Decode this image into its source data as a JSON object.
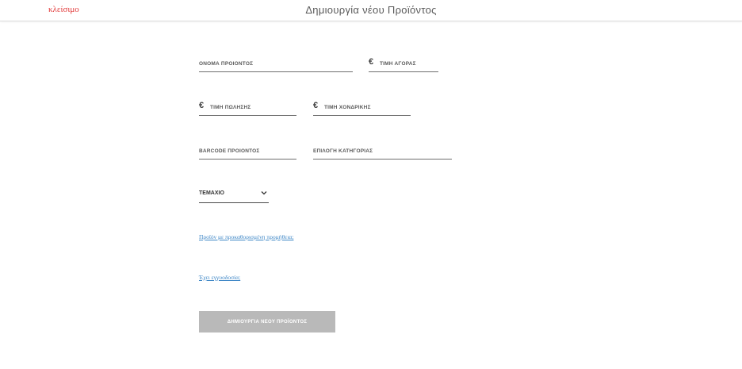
{
  "header": {
    "close_label": "κλείσιμο",
    "title": "Δημιουργία νέου Προϊόντος"
  },
  "form": {
    "currency_symbol": "€",
    "product_name_label": "ΟΝΟΜΑ ΠΡΟΙΟΝΤΟΣ",
    "purchase_price_label": "ΤΙΜΗ ΑΓΟΡΑΣ",
    "sale_price_label": "ΤΙΜΗ ΠΩΛΗΣΗΣ",
    "wholesale_price_label": "ΤΙΜΗ ΧΟΝΔΡΙΚΗΣ",
    "barcode_label": "BARCODE ΠΡΟΙΟΝΤΟΣ",
    "category_label": "ΕΠΙΛΟΓΗ ΚΑΤΗΓΟΡΙΑΣ",
    "unit_select_value": "ΤΕΜΑΧΙΟ",
    "predefined_supply_link": "Προϊόν με προκαθορισμένη προμήθεια;",
    "warranty_link": "Έχει εγγυοδοσία;",
    "submit_label": "ΔΗΜΙΟΥΡΓΙΑ ΝΕΟΥ ΠΡΟΪΟΝΤΟΣ"
  },
  "colors": {
    "close_link": "#e23b3b",
    "link": "#3d86c6",
    "submit_bg": "#b9b9b9"
  },
  "icons": {
    "select_chevron": "chevron-down-icon",
    "currency": "euro-icon"
  }
}
